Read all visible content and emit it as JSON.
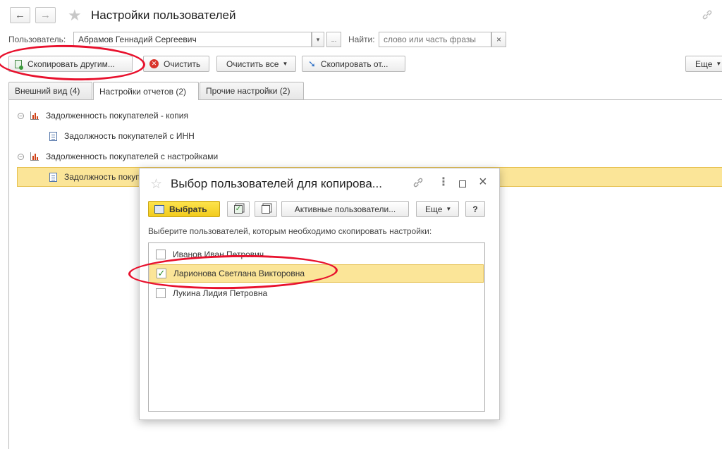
{
  "header": {
    "title": "Настройки пользователей",
    "back_icon": "←",
    "forward_icon": "→",
    "star_icon": "★",
    "link_icon": "🔗"
  },
  "filters": {
    "user_label": "Пользователь:",
    "user_value": "Абрамов Геннадий Сергеевич",
    "dropdown_icon": "▾",
    "select_icon": "...",
    "find_label": "Найти:",
    "find_placeholder": "слово или часть фразы",
    "clear_icon": "×"
  },
  "toolbar": {
    "copy_to_others": "Скопировать другим...",
    "clear": "Очистить",
    "clear_all": "Очистить все",
    "copy_from": "Скопировать от...",
    "more": "Еще"
  },
  "tabs": [
    {
      "label": "Внешний вид (4)"
    },
    {
      "label": "Настройки отчетов (2)"
    },
    {
      "label": "Прочие настройки (2)"
    }
  ],
  "tree": [
    {
      "label": "Задолженность покупателей - копия",
      "level": 0
    },
    {
      "label": "Задолжность покупателей с ИНН",
      "level": 1
    },
    {
      "label": "Задолженность покупателей с настройками",
      "level": 0
    },
    {
      "label": "Задолжность покупателей",
      "level": 1
    }
  ],
  "dialog": {
    "title": "Выбор пользователей для копирова...",
    "select_button": "Выбрать",
    "active_users_button": "Активные пользователи...",
    "more_button": "Еще",
    "help_button": "?",
    "instruction": "Выберите пользователей, которым необходимо скопировать настройки:",
    "users": [
      {
        "name": "Иванов Иван Петрович",
        "checked": false
      },
      {
        "name": "Ларионова Светлана Викторовна",
        "checked": true
      },
      {
        "name": "Лукина Лидия Петровна",
        "checked": false
      }
    ]
  },
  "colors": {
    "selection_bg": "#fbe598",
    "selection_border": "#e6c04e",
    "primary_button": "#f4d432",
    "annotation_red": "#e8112d"
  }
}
